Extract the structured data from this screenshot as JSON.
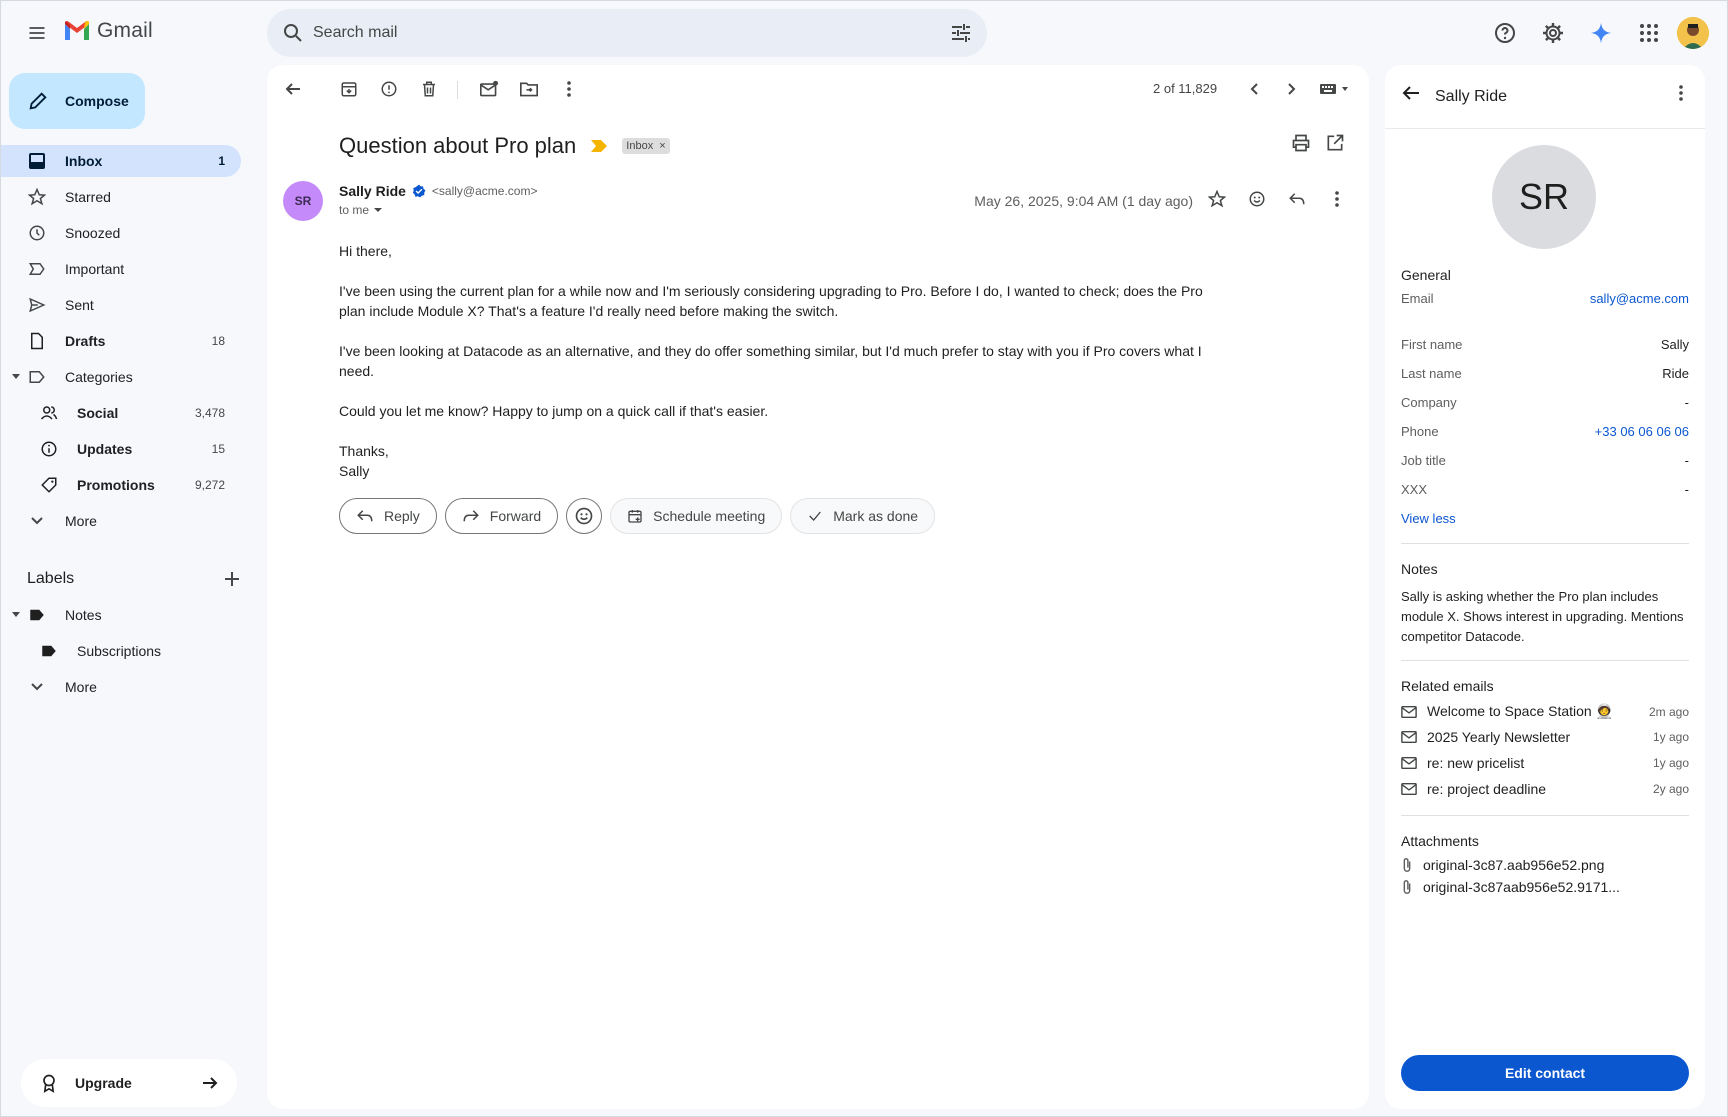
{
  "app": {
    "name": "Gmail"
  },
  "search": {
    "placeholder": "Search mail"
  },
  "compose": {
    "label": "Compose"
  },
  "nav": [
    {
      "label": "Inbox",
      "count": "1"
    },
    {
      "label": "Starred",
      "count": ""
    },
    {
      "label": "Snoozed",
      "count": ""
    },
    {
      "label": "Important",
      "count": ""
    },
    {
      "label": "Sent",
      "count": ""
    },
    {
      "label": "Drafts",
      "count": "18"
    },
    {
      "label": "Categories",
      "count": ""
    },
    {
      "label": "Social",
      "count": "3,478"
    },
    {
      "label": "Updates",
      "count": "15"
    },
    {
      "label": "Promotions",
      "count": "9,272"
    },
    {
      "label": "More",
      "count": ""
    }
  ],
  "labels": {
    "title": "Labels",
    "items": [
      {
        "label": "Notes"
      },
      {
        "label": "Subscriptions"
      },
      {
        "label": "More"
      }
    ]
  },
  "upgrade": {
    "label": "Upgrade"
  },
  "toolbar": {
    "pager": "2 of 11,829"
  },
  "email": {
    "subject": "Question about Pro plan",
    "tag": "Inbox",
    "sender_initials": "SR",
    "sender_name": "Sally Ride",
    "sender_email": "<sally@acme.com>",
    "to": "to me",
    "date": "May 26, 2025, 9:04 AM (1 day ago)",
    "body": [
      "Hi there,",
      "I've been using the current plan for a while now and I'm seriously considering upgrading to Pro. Before I do, I wanted to check; does the Pro plan include Module X? That's a feature I'd really need before making the switch.",
      "I've been looking at Datacode as an alternative, and they do offer something similar, but I'd much prefer to stay with you if Pro covers what I need.",
      "Could you let me know? Happy to jump on a quick call if that's easier.",
      "Thanks,",
      "Sally"
    ]
  },
  "actions": {
    "reply": "Reply",
    "forward": "Forward",
    "schedule": "Schedule meeting",
    "done": "Mark as done"
  },
  "contact": {
    "title": "Sally Ride",
    "initials": "SR",
    "general_title": "General",
    "fields": [
      {
        "key": "Email",
        "value": "sally@acme.com"
      },
      {
        "key": "First name",
        "value": "Sally"
      },
      {
        "key": "Last name",
        "value": "Ride"
      },
      {
        "key": "Company",
        "value": "-"
      },
      {
        "key": "Phone",
        "value": "+33 06 06 06 06"
      },
      {
        "key": "Job title",
        "value": "-"
      },
      {
        "key": "XXX",
        "value": "-"
      }
    ],
    "view_less": "View less",
    "notes_title": "Notes",
    "notes": "Sally is asking whether the Pro plan includes module X. Shows interest in upgrading. Mentions competitor Datacode.",
    "related_title": "Related emails",
    "related": [
      {
        "label": "Welcome to Space Station 🧑‍🚀",
        "time": "2m ago"
      },
      {
        "label": "2025 Yearly Newsletter",
        "time": "1y ago"
      },
      {
        "label": "re: new pricelist",
        "time": "1y ago"
      },
      {
        "label": "re: project deadline",
        "time": "2y ago"
      }
    ],
    "attachments_title": "Attachments",
    "attachments": [
      {
        "name": "original-3c87.aab956e52.png"
      },
      {
        "name": "original-3c87aab956e52.9171..."
      }
    ],
    "edit_label": "Edit contact"
  },
  "colors": {
    "accent": "#0b57d0",
    "compose_bg": "#c2e7ff",
    "active_nav": "#d3e3fd",
    "label_arrow": "#f4b400",
    "sender_avatar": "#c58af9"
  }
}
